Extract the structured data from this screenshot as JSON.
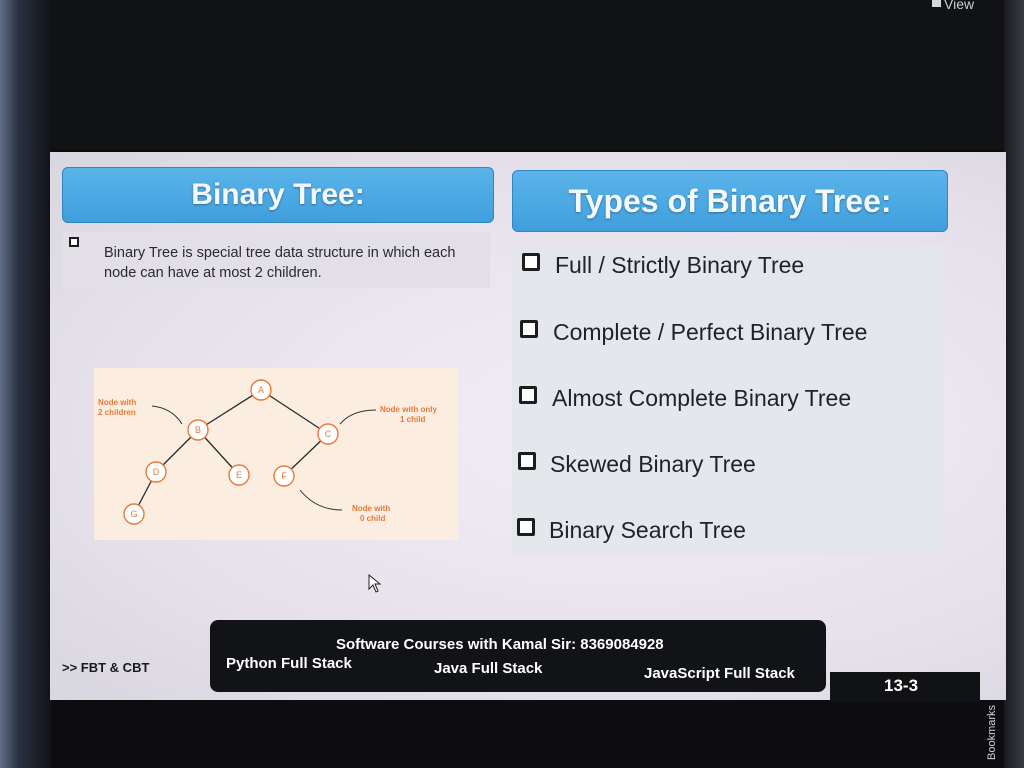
{
  "window": {
    "view_label": "View",
    "bookmarks_label": "Bookmarks"
  },
  "slide": {
    "left_header": "Binary Tree:",
    "definition": "Binary Tree is special tree data structure in which each node can have at most 2 children.",
    "tree_diagram": {
      "nodes": [
        "A",
        "B",
        "C",
        "D",
        "E",
        "F",
        "G"
      ],
      "annotation_two_children": "Node with\n2 children",
      "annotation_one_child": "Node with only\n1 child",
      "annotation_zero_child": "Node with\n0 child"
    },
    "right_header": "Types of Binary Tree:",
    "types": [
      "Full / Strictly Binary Tree",
      "Complete / Perfect Binary Tree",
      "Almost Complete Binary Tree",
      "Skewed Binary Tree",
      "Binary Search Tree"
    ],
    "footer_left": ">> FBT & CBT",
    "banner": {
      "title": "Software Courses with Kamal Sir: 8369084928",
      "courses": [
        "Python Full Stack",
        "Java Full Stack",
        "JavaScript Full Stack"
      ]
    },
    "page_number": "13-3"
  },
  "colors": {
    "header_blue": "#45a6e0",
    "node_orange": "#e8793a",
    "banner_bg": "#121316"
  }
}
